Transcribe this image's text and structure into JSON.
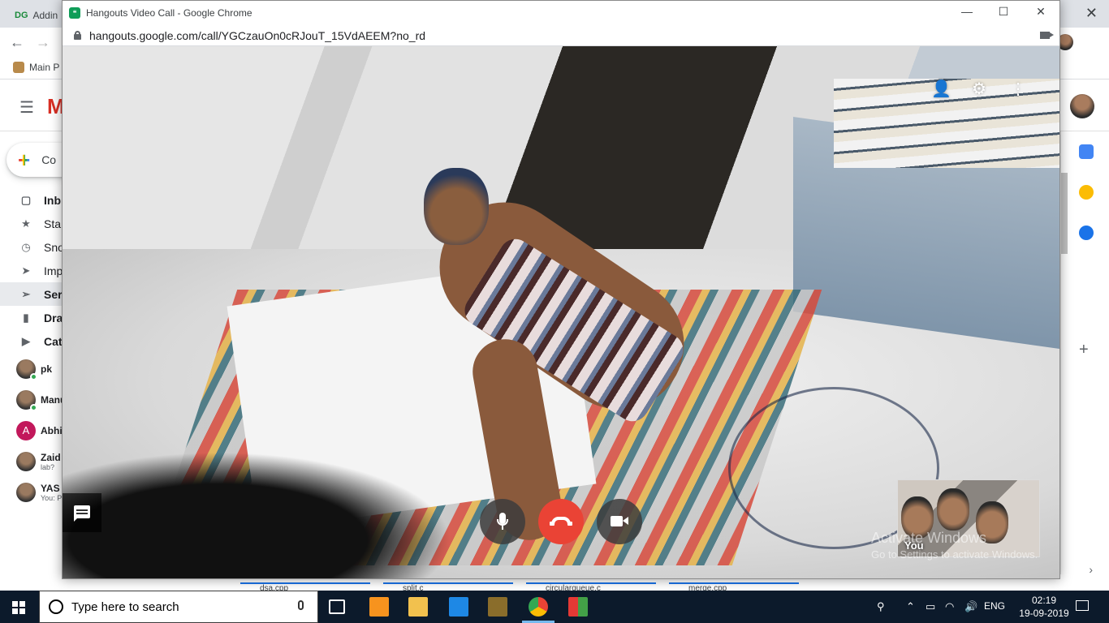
{
  "background_browser": {
    "tab_title": "Addin",
    "tab_icon": "DG",
    "bookmark": "Main P"
  },
  "gmail": {
    "compose_label": "Co",
    "nav": [
      {
        "label": "Inb",
        "icon": "inbox-icon",
        "glyph": "▢",
        "bold": true
      },
      {
        "label": "Sta",
        "icon": "star-icon",
        "glyph": "★"
      },
      {
        "label": "Sno",
        "icon": "snooze-icon",
        "glyph": "◷"
      },
      {
        "label": "Imp",
        "icon": "important-icon",
        "glyph": "➤"
      },
      {
        "label": "Ser",
        "icon": "sent-icon",
        "glyph": "➢",
        "active": true
      },
      {
        "label": "Dra",
        "icon": "drafts-icon",
        "glyph": "▮",
        "bold": true
      },
      {
        "label": "Cat",
        "icon": "label-icon",
        "glyph": "▶",
        "bold": true
      }
    ],
    "chats": [
      {
        "name": "pk",
        "sub": "",
        "online": true
      },
      {
        "name": "Manu",
        "sub": "",
        "online": true
      },
      {
        "name": "Abhi",
        "sub": "",
        "letter": "A",
        "online": true
      },
      {
        "name": "Zaid",
        "sub": "lab?"
      },
      {
        "name": "YAS",
        "sub": "You: P"
      }
    ],
    "drafts": [
      "dsa.cpp",
      "split.c",
      "circularqueue.c",
      "merge.cpp"
    ]
  },
  "hangouts": {
    "window_title": "Hangouts Video Call - Google Chrome",
    "url": "hangouts.google.com/call/YGCzauOn0cRJouT_15VdAEEM?no_rd",
    "self_label": "You",
    "watermark_line1": "Activate Windows",
    "watermark_line2": "Go to Settings to activate Windows."
  },
  "taskbar": {
    "search_placeholder": "Type here to search",
    "language": "ENG",
    "time": "02:19",
    "date": "19-09-2019"
  },
  "colors": {
    "end_call": "#ea4335",
    "taskbar": "#0c1a2b",
    "hangouts_green": "#0f9d58"
  }
}
